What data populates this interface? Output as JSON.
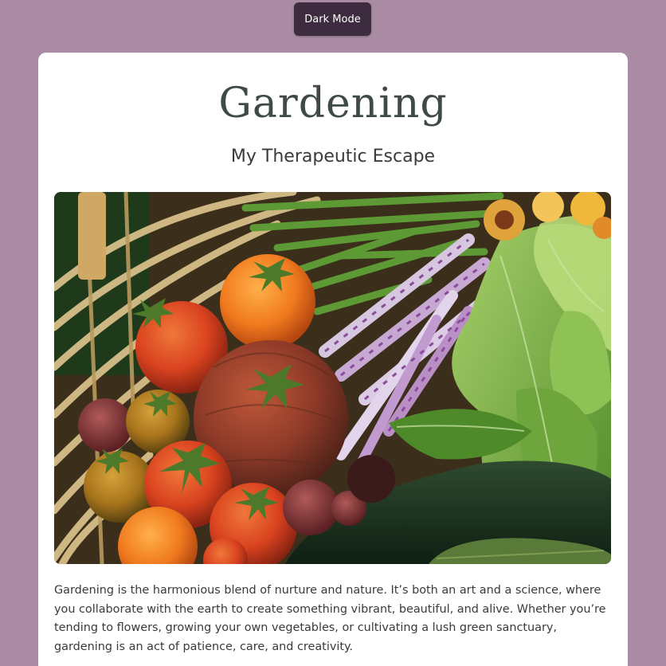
{
  "toggle": {
    "label": "Dark Mode"
  },
  "header": {
    "title": "Gardening",
    "subtitle": "My Therapeutic Escape"
  },
  "hero_image": {
    "icon": "vegetable-harvest-photo"
  },
  "content": {
    "paragraph": "Gardening is the harmonious blend of nurture and nature. It’s both an art and a science, where you collaborate with the earth to create something vibrant, beautiful, and alive. Whether you’re tending to flowers, growing your own vegetables, or cultivating a lush green sanctuary, gardening is an act of patience, care, and creativity."
  },
  "colors": {
    "background": "#a98ba3",
    "button": "#3d2c3f",
    "card": "#ffffff",
    "title": "#3f4a44"
  }
}
